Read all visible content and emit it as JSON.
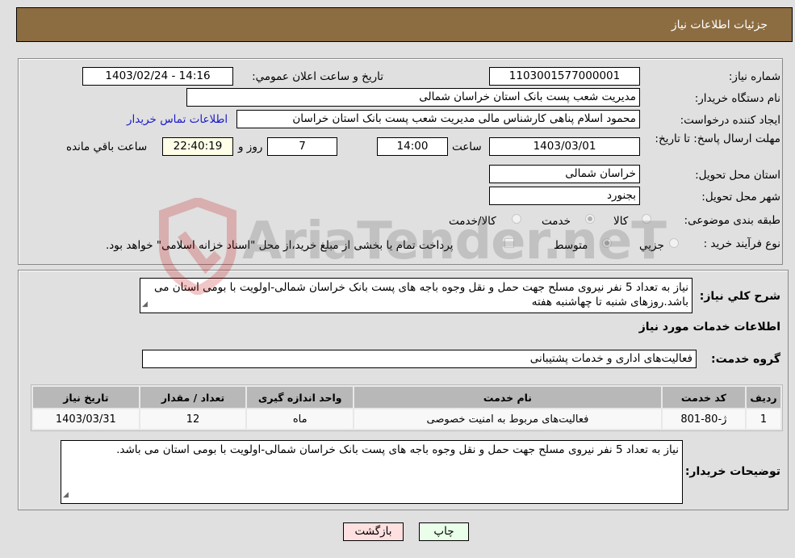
{
  "header": {
    "title": "جزئيات اطلاعات نياز"
  },
  "form": {
    "need_number": {
      "label": "شماره نیاز:",
      "value": "1103001577000001"
    },
    "announce_datetime": {
      "label": "تاريخ و ساعت اعلان عمومي:",
      "value": "1403/02/24 - 14:16"
    },
    "buyer_org": {
      "label": "نام دستگاه خریدار:",
      "value": "مدیریت شعب پست بانک استان خراسان شمالی"
    },
    "requester": {
      "label": "ایجاد کننده درخواست:",
      "value": "محمود  اسلام پناهی  کارشناس مالی مدیریت شعب پست بانک استان خراسان",
      "contact_link": "اطلاعات تماس خریدار"
    },
    "deadline": {
      "label": "مهلت ارسال پاسخ: تا تاریخ:",
      "date": "1403/03/01",
      "time_label": "ساعت",
      "time": "14:00",
      "days": "7",
      "days_label": "روز و",
      "remaining": "22:40:19",
      "remaining_label": "ساعت باقي مانده"
    },
    "delivery_province": {
      "label": "استان محل تحویل:",
      "value": "خراسان شمالی"
    },
    "delivery_city": {
      "label": "شهر محل تحویل:",
      "value": "بجنورد"
    },
    "category": {
      "label": "طبقه بندی موضوعی:",
      "options": [
        "کالا",
        "خدمت",
        "کالا/خدمت"
      ],
      "selected": "خدمت"
    },
    "purchase_type": {
      "label": "نوع فرآیند خرید :",
      "options": [
        "جزيي",
        "متوسط"
      ],
      "selected": "متوسط",
      "treasury_checkbox_label": "پرداخت تمام یا بخشی از مبلغ خرید،از محل \"اسناد خزانه اسلامی\" خواهد بود."
    }
  },
  "summary": {
    "label": "شرح کلي نياز:",
    "text": "نیاز به تعداد 5 نفر نیروی مسلح جهت حمل و نقل وجوه باجه های پست بانک خراسان شمالی-اولویت با بومی استان می باشد.روزهای شنبه تا چهاشنبه هفته"
  },
  "services": {
    "section_title": "اطلاعات خدمات مورد نياز",
    "group_label": "گروه خدمت:",
    "group_value": "فعالیت‌های اداری و خدمات پشتیبانی",
    "table": {
      "headers": [
        "ردیف",
        "کد خدمت",
        "نام خدمت",
        "واحد اندازه گیری",
        "تعداد / مقدار",
        "تاریخ نیاز"
      ],
      "rows": [
        [
          "1",
          "ژ-80-801",
          "فعالیت‌های مربوط به امنیت خصوصی",
          "ماه",
          "12",
          "1403/03/31"
        ]
      ]
    }
  },
  "buyer_notes": {
    "label": "توضیحات خریدار:",
    "text": "نیاز به تعداد 5 نفر نیروی مسلح جهت حمل و نقل وجوه باجه های پست بانک خراسان شمالی-اولویت با بومی استان می باشد."
  },
  "buttons": {
    "print": "چاپ",
    "back": "بازگشت"
  },
  "colors": {
    "header_bg": "#8c6d42",
    "remaining_bg": "#ffffe8",
    "print_bg": "#eaffea",
    "back_bg": "#ffe0e0",
    "link": "#1a1acc"
  },
  "watermark": {
    "text": "AriaTender.neT"
  }
}
